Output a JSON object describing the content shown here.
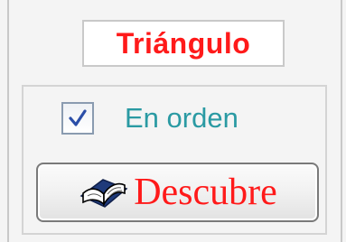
{
  "title": "Triángulo",
  "options": {
    "in_order_label": "En orden",
    "in_order_checked": true
  },
  "actions": {
    "discover_label": "Descubre",
    "discover_icon": "open-book-icon"
  },
  "colors": {
    "title": "#ff1a1a",
    "checkbox_label": "#2a9aa3",
    "button_label": "#ff1a1a"
  }
}
